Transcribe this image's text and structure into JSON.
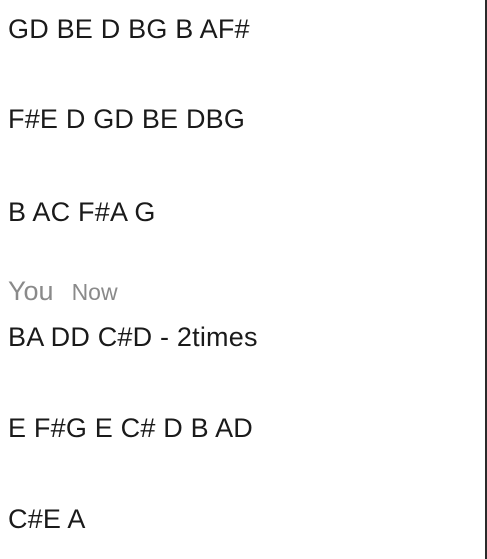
{
  "messages_before": [
    "GD BE D BG B AF#",
    "F#E D GD BE DBG",
    "B AC F#A G"
  ],
  "sender": {
    "name": "You",
    "time": "Now"
  },
  "messages_after": [
    "BA DD C#D - 2times",
    "E F#G E C# D B AD",
    "C#E A"
  ]
}
